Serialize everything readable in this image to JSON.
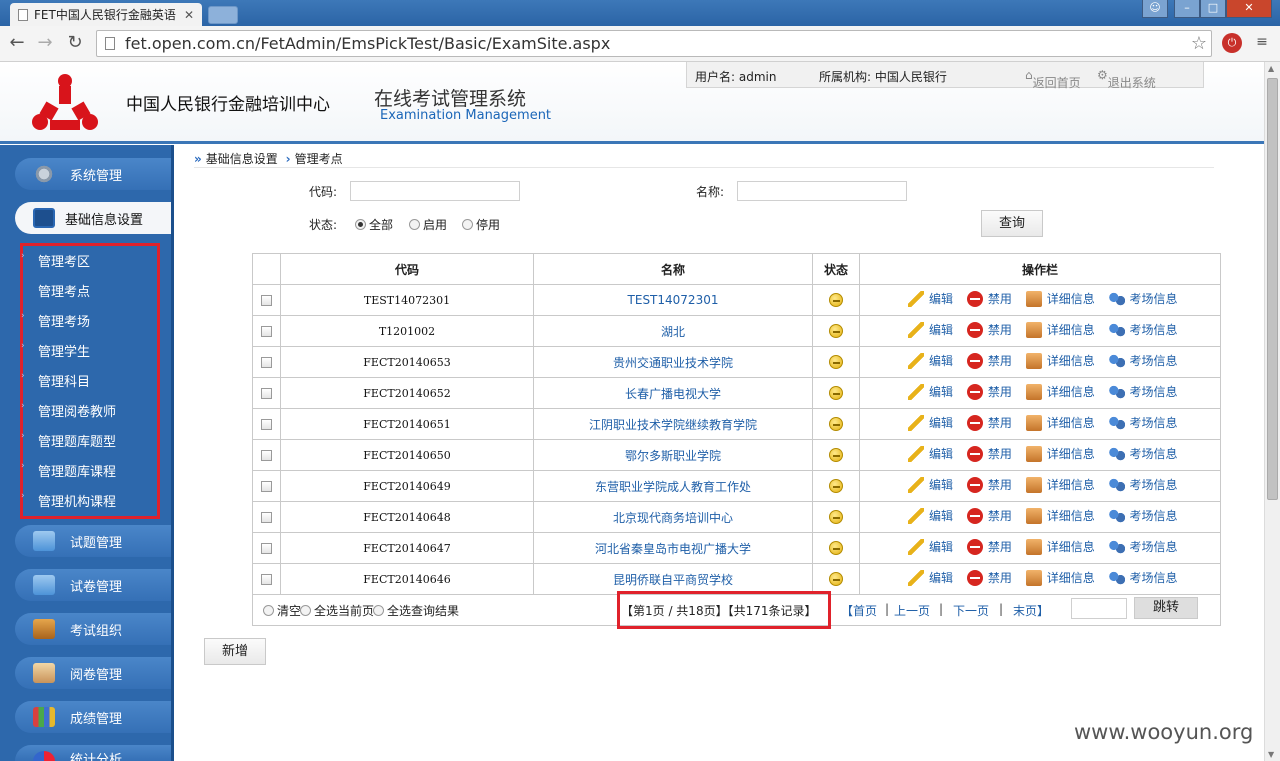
{
  "browser": {
    "tab_title": "FET中国人民银行金融英语",
    "url": "fet.open.com.cn/FetAdmin/EmsPickTest/Basic/ExamSite.aspx"
  },
  "header": {
    "org_name": "中国人民银行金融培训中心",
    "system_name": "在线考试管理系统",
    "system_name_en": "Examination Management",
    "user_label": "用户名: admin",
    "org_label": "所属机构: 中国人民银行",
    "home_link": "返回首页",
    "exit_link": "退出系统"
  },
  "sidebar": {
    "sections": [
      {
        "label": "系统管理",
        "icon": "gear-icon"
      },
      {
        "label": "基础信息设置",
        "icon": "monitor-icon"
      },
      {
        "label": "试题管理",
        "icon": "folder-icon"
      },
      {
        "label": "试卷管理",
        "icon": "folder-icon"
      },
      {
        "label": "考试组织",
        "icon": "cabinet-icon"
      },
      {
        "label": "阅卷管理",
        "icon": "mail-icon"
      },
      {
        "label": "成绩管理",
        "icon": "books-icon"
      },
      {
        "label": "统计分析",
        "icon": "pie-icon"
      }
    ],
    "subitems": [
      "管理考区",
      "管理考点",
      "管理考场",
      "管理学生",
      "管理科目",
      "管理阅卷教师",
      "管理题库题型",
      "管理题库课程",
      "管理机构课程"
    ]
  },
  "breadcrumb": {
    "parent": "基础信息设置",
    "current": "管理考点"
  },
  "filters": {
    "code_label": "代码:",
    "name_label": "名称:",
    "status_label": "状态:",
    "status_options": [
      "全部",
      "启用",
      "停用"
    ],
    "status_selected": "全部",
    "query_button": "查询"
  },
  "table": {
    "headers": [
      "代码",
      "名称",
      "状态",
      "操作栏"
    ],
    "actions": [
      "编辑",
      "禁用",
      "详细信息",
      "考场信息"
    ],
    "rows": [
      {
        "code": "TEST14072301",
        "name": "TEST14072301"
      },
      {
        "code": "T1201002",
        "name": "湖北"
      },
      {
        "code": "FECT20140653",
        "name": "贵州交通职业技术学院"
      },
      {
        "code": "FECT20140652",
        "name": "长春广播电视大学"
      },
      {
        "code": "FECT20140651",
        "name": "江阴职业技术学院继续教育学院"
      },
      {
        "code": "FECT20140650",
        "name": "鄂尔多斯职业学院"
      },
      {
        "code": "FECT20140649",
        "name": "东营职业学院成人教育工作处"
      },
      {
        "code": "FECT20140648",
        "name": "北京现代商务培训中心"
      },
      {
        "code": "FECT20140647",
        "name": "河北省秦皇岛市电视广播大学"
      },
      {
        "code": "FECT20140646",
        "name": "昆明侨联自平商贸学校"
      }
    ]
  },
  "footer": {
    "select_options": [
      "清空",
      "全选当前页",
      "全选查询结果"
    ],
    "page_info": "【第1页 / 共18页】【共171条记录】",
    "first": "【首页",
    "prev": "上一页",
    "next": "下一页",
    "last": "末页】",
    "jump_button": "跳转"
  },
  "add_button": "新增",
  "watermark": "www.wooyun.org",
  "colors": {
    "sidebar": "#2d68ac",
    "accent_link": "#1f5fa8",
    "highlight_box": "#e0222b"
  }
}
